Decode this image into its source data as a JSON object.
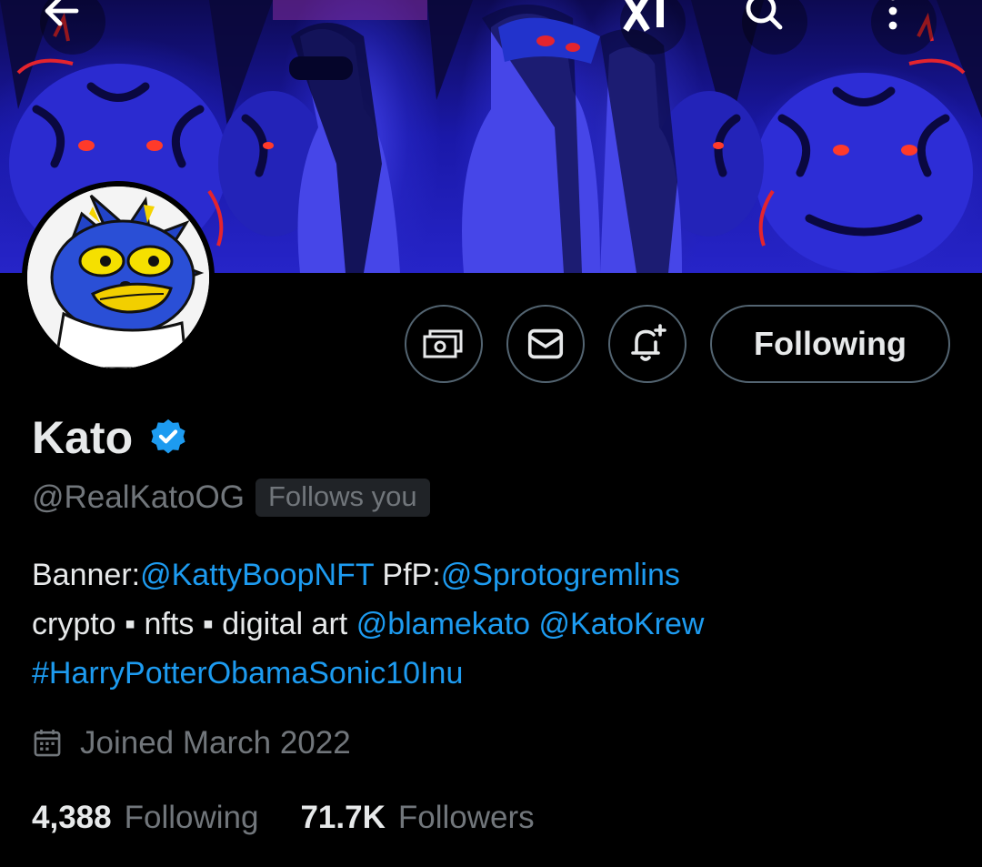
{
  "colors": {
    "background": "#000000",
    "text": "#e7e9ea",
    "muted": "#71767b",
    "link": "#1d9bf0",
    "border": "#536471"
  },
  "topbar": {
    "back_icon": "arrow-left-icon",
    "grok_icon": "grok-icon",
    "search_icon": "search-icon",
    "more_icon": "more-vertical-icon"
  },
  "actions": {
    "tip_icon": "money-icon",
    "message_icon": "mail-icon",
    "notify_icon": "bell-plus-icon",
    "following_label": "Following"
  },
  "profile": {
    "name": "Kato",
    "handle": "@RealKatoOG",
    "follows_you": "Follows you"
  },
  "bio": {
    "line1_prefix": "Banner:",
    "line1_link1": "@KattyBoopNFT",
    "line1_mid": " PfP:",
    "line1_link2": "@Sprotogremlins",
    "line2_text": "crypto ▪ nfts ▪ digital art ",
    "line2_link1": "@blamekato",
    "line2_link2": "@KatoKrew",
    "line3_hashtag": "#HarryPotterObamaSonic10Inu"
  },
  "joined": {
    "icon": "calendar-icon",
    "text": "Joined March 2022"
  },
  "stats": {
    "following_count": "4,388",
    "following_label": "Following",
    "followers_count": "71.7K",
    "followers_label": "Followers"
  }
}
